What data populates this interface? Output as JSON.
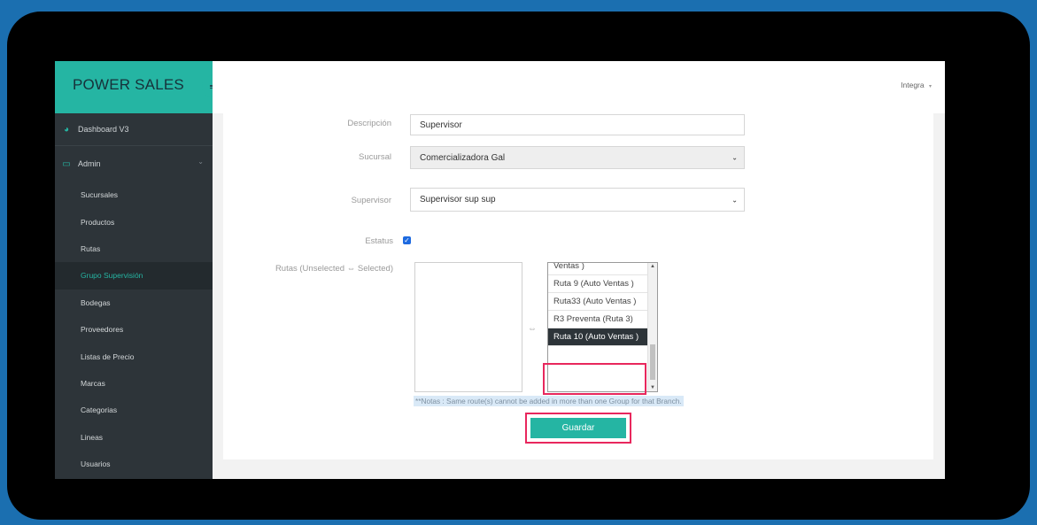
{
  "app": {
    "brand": "POWER SALES",
    "user_menu": "Integra"
  },
  "nav": {
    "dashboard": "Dashboard V3",
    "admin": "Admin",
    "items": [
      "Sucursales",
      "Productos",
      "Rutas",
      "Grupo Supervisión",
      "Bodegas",
      "Proveedores",
      "Listas de Precio",
      "Marcas",
      "Categorias",
      "Lineas",
      "Usuarios"
    ],
    "active_index": 3
  },
  "form": {
    "descripcion_label": "Descripción",
    "descripcion_value": "Supervisor",
    "sucursal_label": "Sucursal",
    "sucursal_value": "Comercializadora Gal",
    "supervisor_label": "Supervisor",
    "supervisor_value": "Supervisor sup sup",
    "estatus_label": "Estatus",
    "estatus_checked": true,
    "rutas_label": "Rutas (Unselected ⇔ Selected)",
    "selected_routes": [
      "Ventas )",
      "Ruta 9 (Auto Ventas )",
      "Ruta33 (Auto Ventas )",
      "R3 Preventa (Ruta 3)",
      "Ruta 10 (Auto Ventas )"
    ],
    "highlighted_route_index": 4,
    "transfer_arrows": "⇔",
    "note": "**Notas : Same route(s) cannot be added in more than one Group for that Branch.",
    "save_label": "Guardar"
  },
  "colors": {
    "accent": "#25b5a3",
    "sidebar": "#2d3439",
    "highlight": "#e8275d",
    "background": "#1b6fb0"
  }
}
